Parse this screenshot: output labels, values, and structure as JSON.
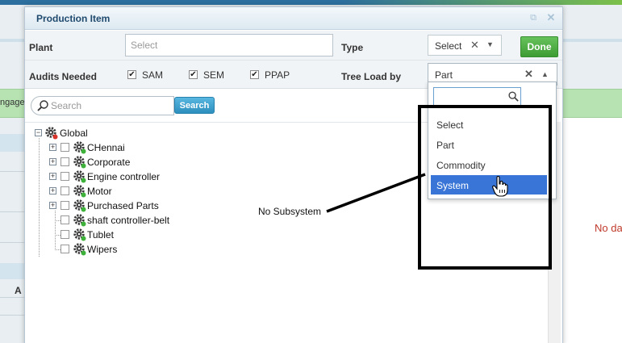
{
  "background": {
    "left_label": "ngage",
    "left_column_letter": "A",
    "right_message": "No da"
  },
  "dialog": {
    "title": "Production Item",
    "restore_icon": "restore-icon",
    "close_icon": "close-icon"
  },
  "form": {
    "plant_label": "Plant",
    "plant_placeholder": "Select",
    "type_label": "Type",
    "type_value": "Select",
    "done_label": "Done",
    "audits_label": "Audits Needed",
    "audits": [
      {
        "label": "SAM",
        "checked": true
      },
      {
        "label": "SEM",
        "checked": true
      },
      {
        "label": "PPAP",
        "checked": true
      }
    ],
    "tree_load_label": "Tree Load by",
    "tree_load_value": "Part"
  },
  "search": {
    "placeholder": "Search",
    "button_label": "Search"
  },
  "tree": {
    "root": "Global",
    "children": [
      {
        "label": "CHennai",
        "expandable": true
      },
      {
        "label": "Corporate",
        "expandable": true
      },
      {
        "label": "Engine controller",
        "expandable": true
      },
      {
        "label": "Motor",
        "expandable": true
      },
      {
        "label": "Purchased Parts",
        "expandable": true
      },
      {
        "label": "shaft controller-belt",
        "expandable": false
      },
      {
        "label": "Tublet",
        "expandable": false
      },
      {
        "label": "Wipers",
        "expandable": false
      }
    ]
  },
  "dropdown": {
    "search_value": "",
    "options": [
      "Select",
      "Part",
      "Commodity",
      "System"
    ],
    "highlighted_index": 3
  },
  "annotation": {
    "text": "No Subsystem"
  },
  "colors": {
    "done_green": "#4caf3f",
    "search_blue": "#3aa0cf",
    "highlight_blue": "#3875d7",
    "gear_dark": "#3a3a3a",
    "gear_badge_green": "#3db13a",
    "gear_badge_red": "#d9342b"
  }
}
